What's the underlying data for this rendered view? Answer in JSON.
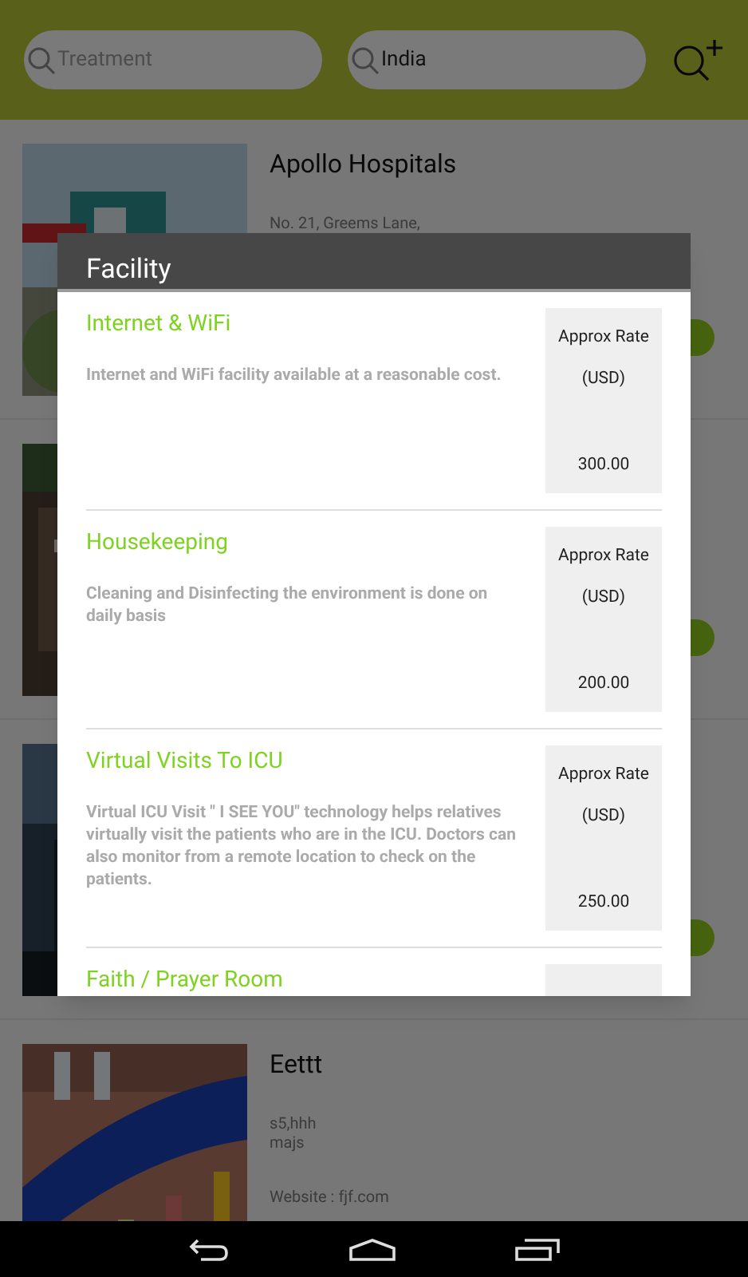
{
  "search_bar": {
    "treatment_field": {
      "placeholder": "Treatment"
    },
    "location_field": {
      "value": "India"
    }
  },
  "hospitals": [
    {
      "name": "Apollo Hospitals",
      "address_lines": [
        "No. 21, Greems Lane,"
      ],
      "details_button": true
    },
    {
      "details_button": true
    },
    {
      "details_button": true
    },
    {
      "name": "Eettt",
      "address_lines": [
        "s5,hhh",
        "majs"
      ],
      "website": "Website : fjf.com"
    }
  ],
  "dialog": {
    "title": "Facility",
    "facilities": [
      {
        "name": "Internet & WiFi",
        "description": "Internet and WiFi facility available at a reasonable cost.",
        "rate_label": "Approx Rate",
        "currency": "(USD)",
        "price": "300.00"
      },
      {
        "name": "Housekeeping",
        "description": "Cleaning and Disinfecting the environment is done on daily basis",
        "rate_label": "Approx Rate",
        "currency": "(USD)",
        "price": "200.00"
      },
      {
        "name": "Virtual Visits To ICU",
        "description": "Virtual ICU Visit  \" I SEE YOU\"  technology helps relatives virtually visit the patients who are in the ICU. Doctors can also monitor from a remote location to check on the patients.",
        "rate_label": "Approx Rate",
        "currency": "(USD)",
        "price": "250.00"
      },
      {
        "name": "Faith / Prayer Room"
      }
    ]
  }
}
